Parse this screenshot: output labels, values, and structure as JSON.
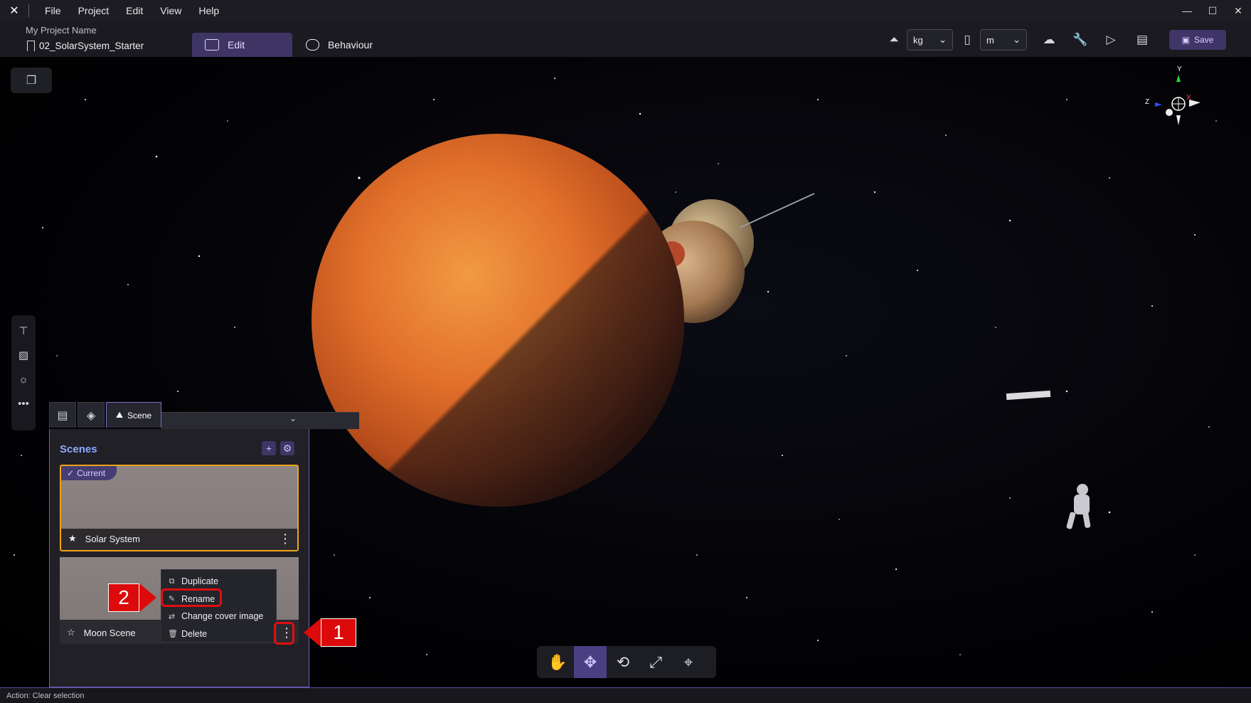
{
  "menubar": {
    "items": [
      "File",
      "Project",
      "Edit",
      "View",
      "Help"
    ]
  },
  "project": {
    "name": "My Project Name",
    "file": "02_SolarSystem_Starter"
  },
  "modes": {
    "edit": "Edit",
    "behaviour": "Behaviour"
  },
  "units": {
    "mass": "kg",
    "length": "m"
  },
  "save_label": "Save",
  "panel": {
    "scene_tab": "Scene",
    "title": "Scenes",
    "current_badge": "Current",
    "scenes": [
      {
        "name": "Solar System",
        "current": true
      },
      {
        "name": "Moon Scene",
        "current": false
      }
    ]
  },
  "context_menu": {
    "items": [
      "Duplicate",
      "Rename",
      "Change cover image",
      "Delete"
    ]
  },
  "callouts": {
    "one": "1",
    "two": "2"
  },
  "statusbar": {
    "text": "Action: Clear selection"
  },
  "gizmo": {
    "y": "Y",
    "z": "Z",
    "x": "X"
  },
  "colors": {
    "accent": "#3e3565",
    "highlight_red": "#dc0a0a",
    "current_border": "#f0a419",
    "scenes_title": "#8fa9ff"
  }
}
